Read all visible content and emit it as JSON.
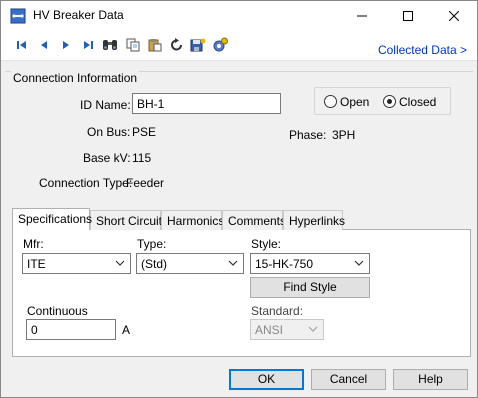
{
  "window": {
    "title": "HV Breaker Data"
  },
  "toolbar": {
    "collected_link": "Collected Data >",
    "icons": [
      "first-record-icon",
      "prev-record-icon",
      "next-record-icon",
      "last-record-icon",
      "find-icon",
      "copy-icon",
      "paste-icon",
      "undo-icon",
      "save-icon",
      "settings-icon"
    ]
  },
  "connection": {
    "group_title": "Connection Information",
    "id_label": "ID Name:",
    "id_value": "BH-1",
    "on_bus_label": "On Bus:",
    "on_bus_value": "PSE",
    "base_kv_label": "Base kV:",
    "base_kv_value": "115",
    "conn_type_label": "Connection Type:",
    "conn_type_value": "Feeder",
    "phase_label": "Phase:",
    "phase_value": "3PH",
    "open_label": "Open",
    "closed_label": "Closed",
    "state": "Closed"
  },
  "tabs": [
    {
      "label": "Specifications",
      "active": true
    },
    {
      "label": "Short Circuit"
    },
    {
      "label": "Harmonics"
    },
    {
      "label": "Comments"
    },
    {
      "label": "Hyperlinks"
    }
  ],
  "spec": {
    "mfr_label": "Mfr:",
    "mfr_value": "ITE",
    "type_label": "Type:",
    "type_value": "(Std)",
    "style_label": "Style:",
    "style_value": "15-HK-750",
    "find_style": "Find Style",
    "continuous_label": "Continuous",
    "continuous_value": "0",
    "continuous_unit": "A",
    "standard_label": "Standard:",
    "standard_value": "ANSI"
  },
  "footer": {
    "ok": "OK",
    "cancel": "Cancel",
    "help": "Help"
  },
  "colors": {
    "accent": "#0078d7",
    "link": "#0033cc",
    "nav_blue": "#1f5fbf"
  }
}
